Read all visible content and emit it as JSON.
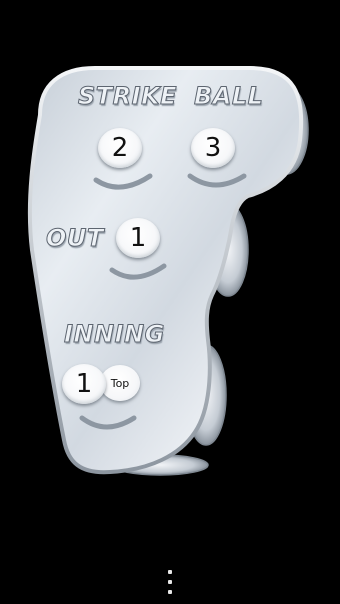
{
  "umpire_indicator": {
    "labels": {
      "strike": "STRIKE",
      "ball": "BALL",
      "out": "OUT",
      "inning": "INNING"
    },
    "counts": {
      "strike": "2",
      "ball": "3",
      "out": "1",
      "inning": "1"
    },
    "inning_half": "Top"
  },
  "nav": {
    "overflow_icon": "more-vertical-icon"
  },
  "colors": {
    "background": "#000000",
    "panel": "#dfe5ec",
    "label_fill": "#eef2f6",
    "label_outline": "#5d6570",
    "button": "#ffffff",
    "digit": "#111111"
  }
}
